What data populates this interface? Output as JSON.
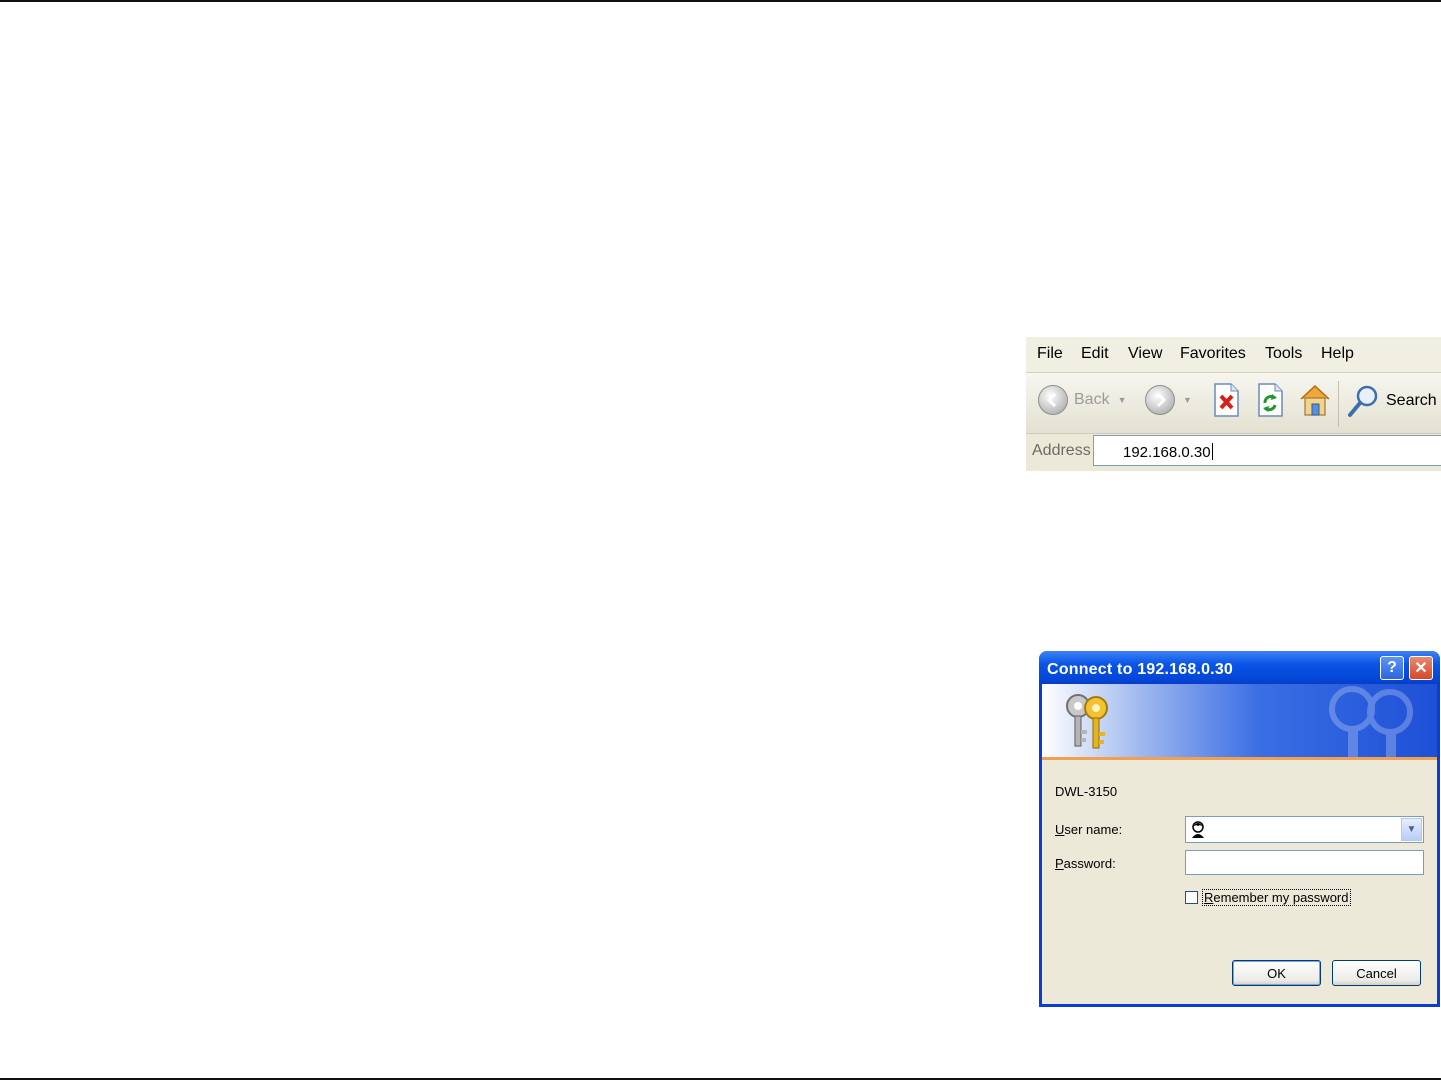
{
  "browser": {
    "menu": [
      "File",
      "Edit",
      "View",
      "Favorites",
      "Tools",
      "Help"
    ],
    "toolbar": {
      "back_label": "Back",
      "search_label": "Search"
    },
    "address": {
      "label": "Address",
      "value": "192.168.0.30"
    }
  },
  "dialog": {
    "title": "Connect to 192.168.0.30",
    "realm": "DWL-3150",
    "username_label_prefix": "U",
    "username_label_rest": "ser name:",
    "password_label_prefix": "P",
    "password_label_rest": "assword:",
    "username_value": "",
    "password_value": "",
    "remember_prefix": "R",
    "remember_rest": "emember my password",
    "remember_checked": false,
    "ok_label": "OK",
    "cancel_label": "Cancel",
    "help_glyph": "?",
    "close_glyph": "✕"
  },
  "colors": {
    "titlebar": "#0a54e6",
    "dialog_bg": "#ece9d8",
    "stop_red": "#d7201a",
    "refresh_green": "#1e9a2c"
  }
}
